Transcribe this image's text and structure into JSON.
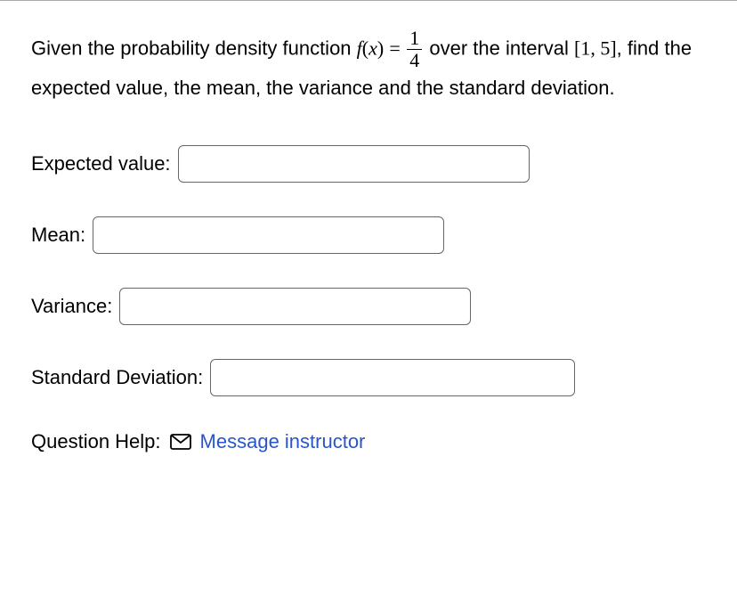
{
  "question": {
    "prefix": "Given the probability density function ",
    "func_name": "f",
    "func_arg": "x",
    "equals": " = ",
    "frac_num": "1",
    "frac_den": "4",
    "mid": " over the interval ",
    "interval": "[1, 5]",
    "suffix": ", find the expected value, the mean, the variance and the standard deviation."
  },
  "fields": {
    "expected_label": "Expected value:",
    "mean_label": "Mean:",
    "variance_label": "Variance:",
    "sd_label": "Standard Deviation:",
    "expected_value": "",
    "mean_value": "",
    "variance_value": "",
    "sd_value": ""
  },
  "help": {
    "label": "Question Help:",
    "link": "Message instructor"
  }
}
